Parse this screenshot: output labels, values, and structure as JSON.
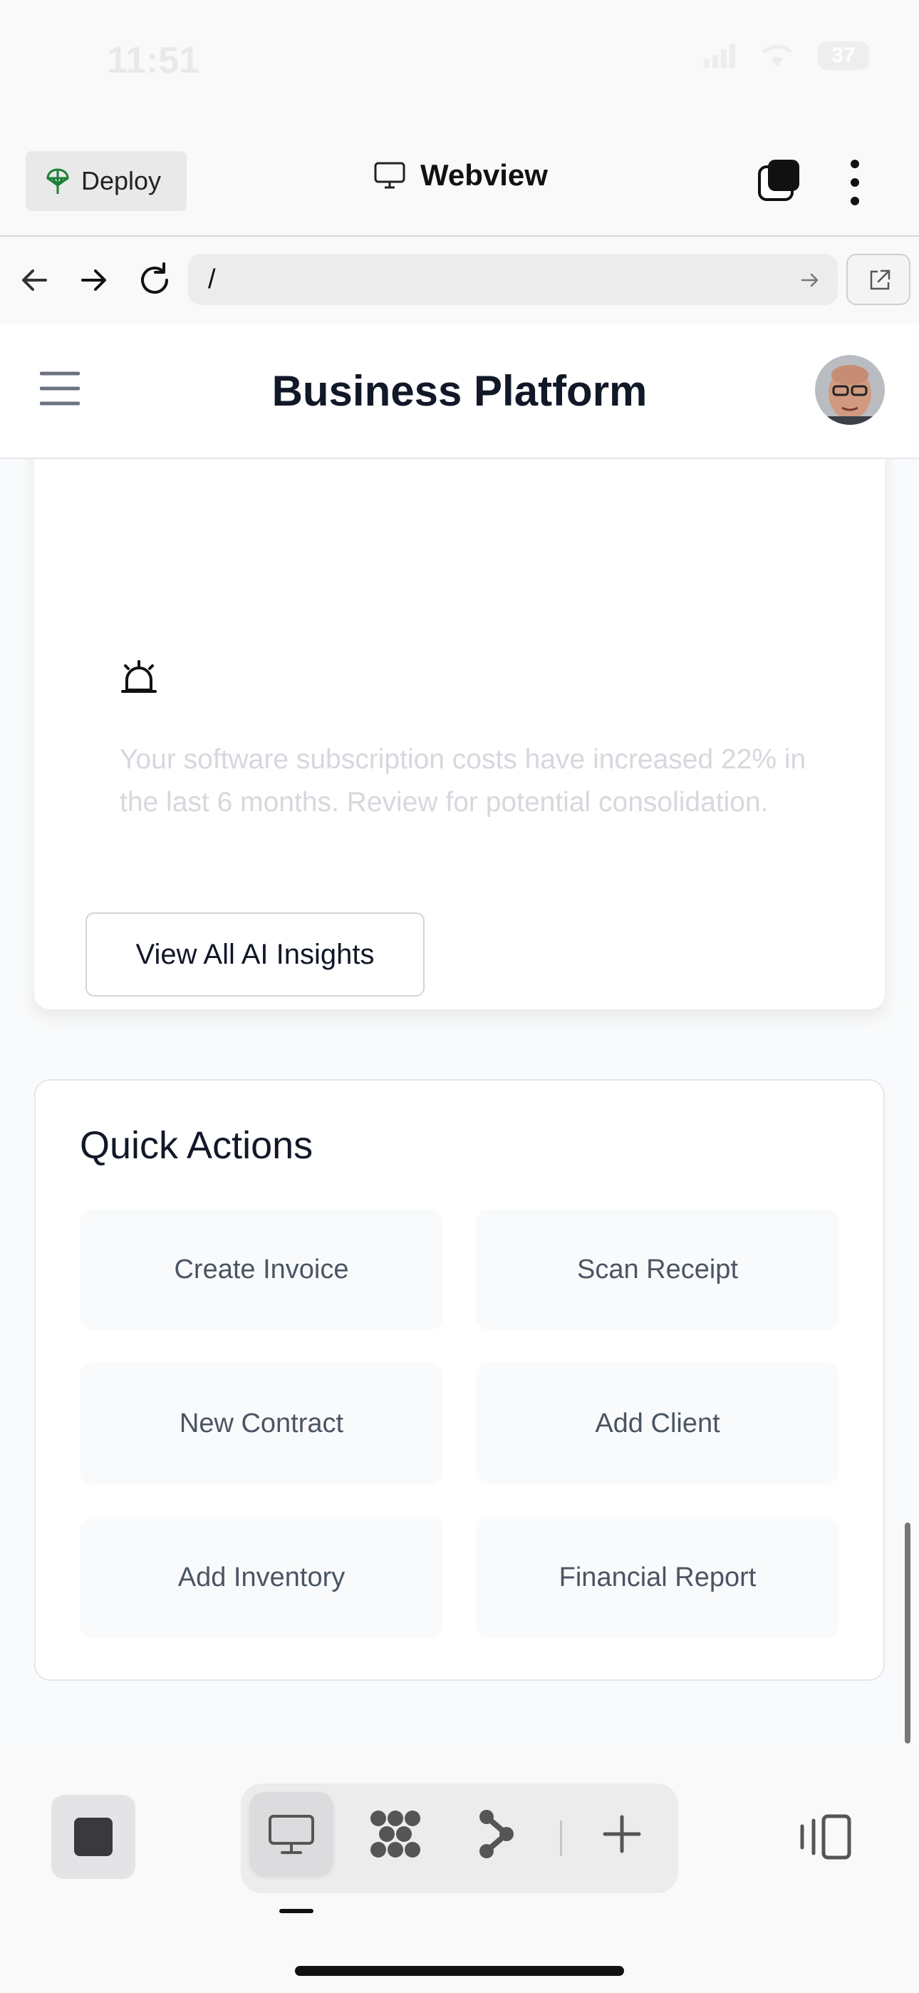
{
  "status_bar": {
    "time": "11:51",
    "battery": "37"
  },
  "top_bar": {
    "deploy_label": "Deploy",
    "title": "Webview"
  },
  "url_bar": {
    "url": "/"
  },
  "page": {
    "title": "Business Platform",
    "insight": {
      "text": "Your software subscription costs have increased 22% in the last 6 months. Review for potential consolidation."
    },
    "view_all_label": "View All AI Insights",
    "quick_actions": {
      "title": "Quick Actions",
      "items": [
        "Create Invoice",
        "Scan Receipt",
        "New Contract",
        "Add Client",
        "Add Inventory",
        "Financial Report"
      ]
    }
  },
  "icons": {
    "deploy": "deploy-icon",
    "monitor": "monitor-icon",
    "tabs": "tabs-icon",
    "more": "more-vertical-icon",
    "back": "back-arrow-icon",
    "forward": "forward-arrow-icon",
    "reload": "reload-icon",
    "open_external": "open-external-icon",
    "menu": "hamburger-icon",
    "alarm": "alarm-icon"
  },
  "colors": {
    "deploy_green": "#1a7f37",
    "insight_text": "#d5d8dd",
    "quick_action_bg": "#f9fafb"
  }
}
